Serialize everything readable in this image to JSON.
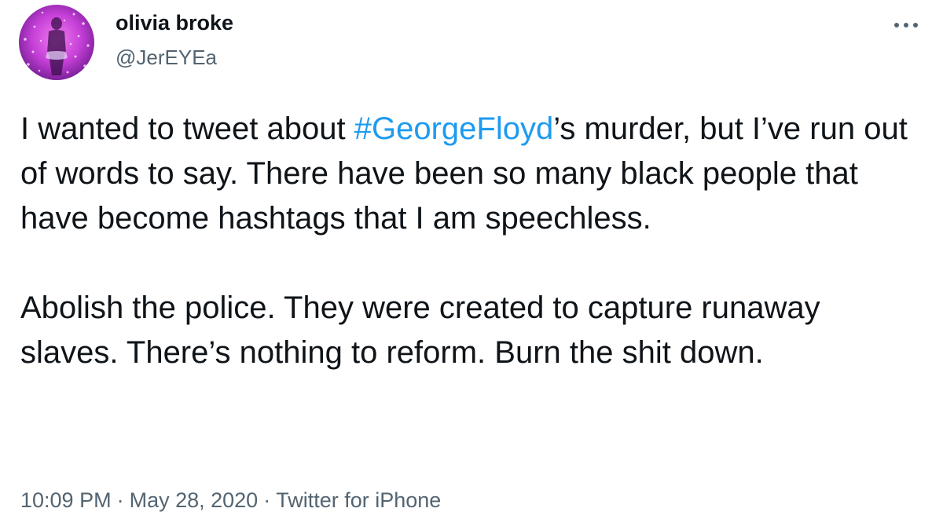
{
  "user": {
    "display_name": "olivia broke",
    "handle": "@JerEYEa"
  },
  "tweet": {
    "paragraph1_before_hashtag": "I wanted to tweet about ",
    "hashtag": "#GeorgeFloyd",
    "paragraph1_after_hashtag": "’s murder, but I’ve run out of words to say. There have been so many black people that have become hashtags that I am speechless.",
    "paragraph2": "Abolish the police. They were created to capture runaway slaves. There’s nothing to reform. Burn the shit down."
  },
  "meta": {
    "time": "10:09 PM",
    "separator": "·",
    "date": "May 28, 2020",
    "source": "Twitter for iPhone"
  },
  "colors": {
    "link": "#1d9bf0",
    "text": "#0f1419",
    "secondary": "#536471"
  },
  "icons": {
    "more": "more-horizontal-icon"
  }
}
